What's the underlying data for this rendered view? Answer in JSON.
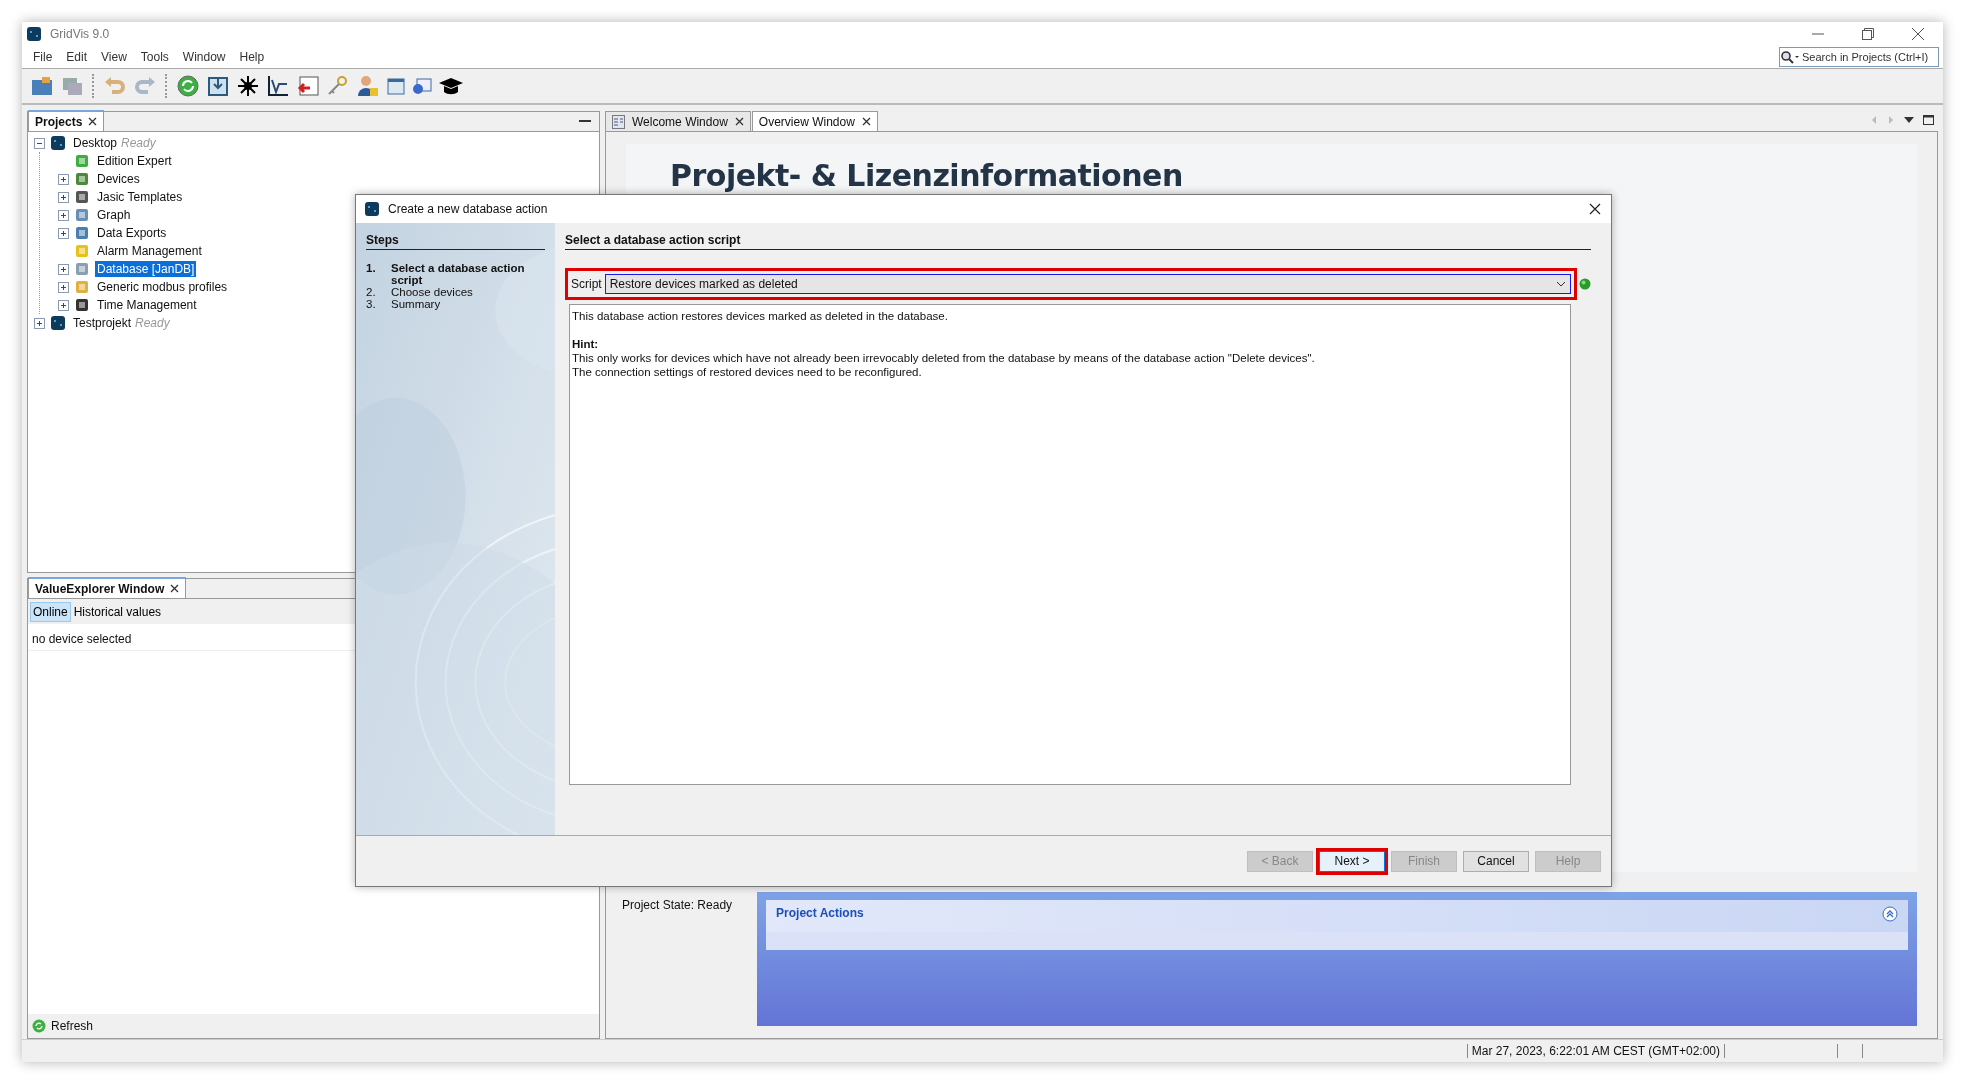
{
  "window": {
    "title": "GridVis 9.0"
  },
  "menu": [
    "File",
    "Edit",
    "View",
    "Tools",
    "Window",
    "Help"
  ],
  "search": {
    "placeholder": "Search in Projects (Ctrl+I)"
  },
  "projects_panel": {
    "title": "Projects",
    "tree": [
      {
        "label": "Desktop",
        "status": "Ready",
        "expanded": true,
        "selected": false,
        "children": [
          {
            "label": "Edition Expert",
            "selected": false
          },
          {
            "label": "Devices",
            "expanded": false,
            "selected": false
          },
          {
            "label": "Jasic Templates",
            "expanded": false,
            "selected": false
          },
          {
            "label": "Graph",
            "expanded": false,
            "selected": false
          },
          {
            "label": "Data Exports",
            "expanded": false,
            "selected": false
          },
          {
            "label": "Alarm Management",
            "selected": false
          },
          {
            "label": "Database [JanDB]",
            "expanded": false,
            "selected": true
          },
          {
            "label": "Generic modbus profiles",
            "expanded": false,
            "selected": false
          },
          {
            "label": "Time Management",
            "expanded": false,
            "selected": false
          }
        ]
      },
      {
        "label": "Testprojekt",
        "status": "Ready",
        "expanded": false,
        "selected": false
      }
    ]
  },
  "value_explorer": {
    "title": "ValueExplorer Window",
    "modes": [
      {
        "label": "Online",
        "selected": true
      },
      {
        "label": "Historical values",
        "selected": false
      }
    ],
    "message": "no device selected",
    "refresh": "Refresh"
  },
  "editor": {
    "tabs": [
      {
        "label": "Welcome Window",
        "selected": false
      },
      {
        "label": "Overview Window",
        "selected": true
      }
    ],
    "heading": "Projekt- & Lizenzinformationen",
    "project_state": "Project State: Ready",
    "project_actions": "Project Actions"
  },
  "dialog": {
    "title": "Create a new database action",
    "steps_title": "Steps",
    "steps": [
      {
        "number": "1.",
        "label": "Select a database action script",
        "selected": true
      },
      {
        "number": "2.",
        "label": "Choose devices",
        "selected": false
      },
      {
        "number": "3.",
        "label": "Summary",
        "selected": false
      }
    ],
    "section_title": "Select a database action script",
    "script": {
      "label": "Script",
      "value": "Restore devices marked as deleted",
      "highlighted": true
    },
    "description": "This database action restores devices marked as deleted in the database.",
    "hint_title": "Hint:",
    "hint_lines": [
      "This only works for devices which have not already been irrevocably deleted from the database by means of the database action \"Delete devices\".",
      "The connection settings of restored devices need to be reconfigured."
    ],
    "buttons": [
      {
        "label": "< Back",
        "disabled": true,
        "highlighted": false
      },
      {
        "label": "Next >",
        "disabled": false,
        "highlighted": true
      },
      {
        "label": "Finish",
        "disabled": true,
        "highlighted": false
      },
      {
        "label": "Cancel",
        "disabled": false,
        "highlighted": false
      },
      {
        "label": "Help",
        "disabled": true,
        "highlighted": false
      }
    ]
  },
  "status_bar": {
    "datetime": "Mar 27, 2023, 6:22:01 AM CEST (GMT+02:00)"
  }
}
